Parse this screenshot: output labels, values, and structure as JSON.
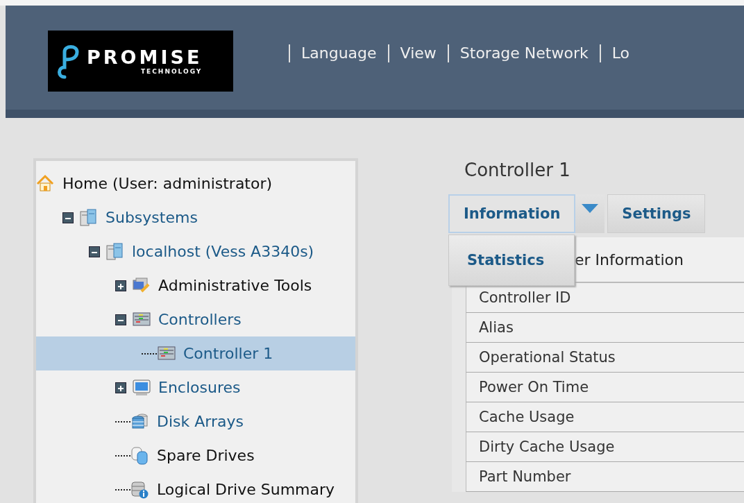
{
  "header": {
    "logo": {
      "name": "PROMISE",
      "tagline": "TECHNOLOGY"
    },
    "nav": [
      "Language",
      "View",
      "Storage Network",
      "Lo"
    ]
  },
  "tree": [
    {
      "label": "Home (User: administrator)",
      "kind": "home",
      "link": false,
      "selected": false,
      "children": [
        {
          "label": "Subsystems",
          "kind": "server",
          "link": true,
          "selected": false,
          "expanded": true,
          "children": [
            {
              "label": "localhost (Vess A3340s)",
              "kind": "server",
              "link": true,
              "selected": false,
              "expanded": true,
              "children": [
                {
                  "label": "Administrative Tools",
                  "kind": "tools",
                  "link": false,
                  "selected": false,
                  "expanded": false
                },
                {
                  "label": "Controllers",
                  "kind": "controller",
                  "link": true,
                  "selected": false,
                  "expanded": true,
                  "children": [
                    {
                      "label": "Controller 1",
                      "kind": "controller",
                      "link": true,
                      "selected": true
                    }
                  ]
                },
                {
                  "label": "Enclosures",
                  "kind": "monitor",
                  "link": true,
                  "selected": false,
                  "expanded": false
                },
                {
                  "label": "Disk Arrays",
                  "kind": "disks",
                  "link": true,
                  "selected": false
                },
                {
                  "label": "Spare Drives",
                  "kind": "spare",
                  "link": false,
                  "selected": false
                },
                {
                  "label": "Logical Drive Summary",
                  "kind": "summary",
                  "link": false,
                  "selected": false
                }
              ]
            }
          ]
        }
      ]
    }
  ],
  "main": {
    "title": "Controller 1",
    "tabs": [
      {
        "label": "Information",
        "selected": true
      },
      {
        "label": "Settings",
        "selected": false
      }
    ],
    "dropdown": {
      "items": [
        "Statistics"
      ]
    },
    "section_title": "er Information",
    "rows": [
      "Controller ID",
      "Alias",
      "Operational Status",
      "Power On Time",
      "Cache Usage",
      "Dirty Cache Usage",
      "Part Number"
    ]
  }
}
